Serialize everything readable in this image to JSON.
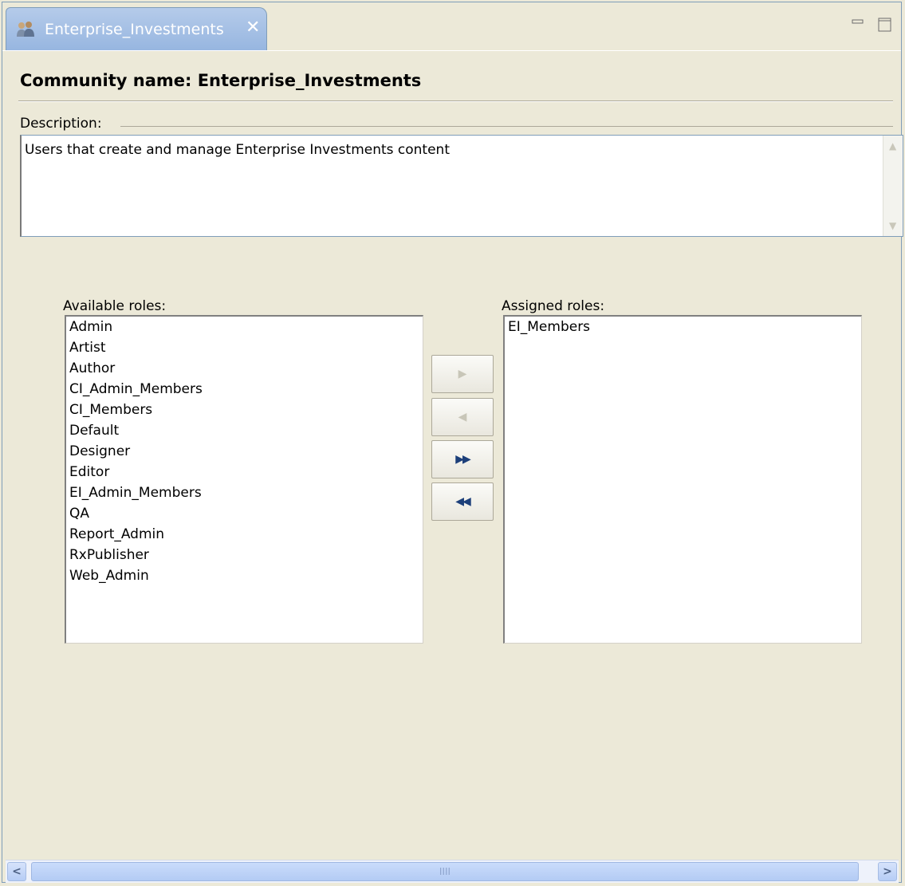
{
  "tab": {
    "title": "Enterprise_Investments",
    "close_glyph": "✕",
    "icon": "community-icon"
  },
  "window_controls": [
    "minimize-icon",
    "maximize-icon"
  ],
  "heading": "Community name: Enterprise_Investments",
  "description": {
    "label": "Description:",
    "value": "Users that create and manage Enterprise Investments content"
  },
  "available": {
    "label": "Available roles:",
    "items": [
      "Admin",
      "Artist",
      "Author",
      "CI_Admin_Members",
      "CI_Members",
      "Default",
      "Designer",
      "Editor",
      "EI_Admin_Members",
      "QA",
      "Report_Admin",
      "RxPublisher",
      "Web_Admin"
    ]
  },
  "assigned": {
    "label": "Assigned roles:",
    "items": [
      "EI_Members"
    ]
  },
  "move_buttons": {
    "add": "▶",
    "remove": "◀",
    "add_all": "▶▶",
    "remove_all": "◀◀"
  },
  "hscroll": {
    "left": "<",
    "right": ">",
    "grip": "IIII"
  },
  "colors": {
    "background": "#ece9d8",
    "tab_active": "#97b6e0",
    "border": "#7f9db9"
  }
}
